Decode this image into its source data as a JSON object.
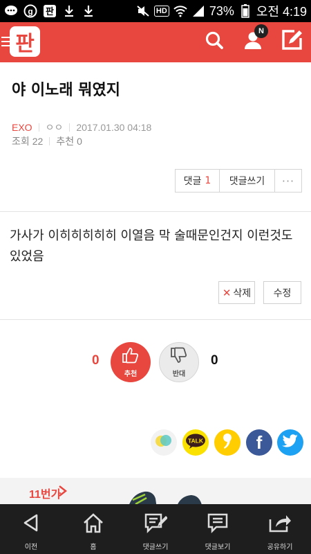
{
  "status_bar": {
    "battery": "73%",
    "time": "오전 4:19",
    "hd_label": "HD",
    "icons": [
      "chat-bubble-icon",
      "g-app-icon",
      "pan-app-icon",
      "download-icon",
      "download-icon",
      "mute-icon",
      "hd-icon",
      "wifi-icon",
      "signal-icon",
      "battery-icon"
    ]
  },
  "header": {
    "logo": "판",
    "notification_badge": "N",
    "icons": [
      "menu-icon",
      "search-icon",
      "user-icon",
      "write-icon"
    ],
    "color": "#e8473f"
  },
  "post": {
    "title": "야 이노래 뭐였지",
    "author": "EXO",
    "nickname": "ㅇㅇ",
    "date": "2017.01.30 04:18",
    "views_label": "조회",
    "views": "22",
    "recommend_label": "추천",
    "recommend": "0"
  },
  "actions": {
    "comment_label": "댓글",
    "comment_count": "1",
    "write_comment_label": "댓글쓰기",
    "more": "···"
  },
  "comment": {
    "text": "가사가 이히히히히히 이열음 막 술때문인건지 이런것도 있었음",
    "delete_label": "삭제",
    "edit_label": "수정"
  },
  "vote": {
    "up_count": "0",
    "up_label": "추천",
    "down_label": "반대",
    "down_count": "0"
  },
  "share": {
    "icons": [
      "share-multi-icon",
      "kakaotalk-icon",
      "kakaostory-icon",
      "facebook-icon",
      "twitter-icon"
    ],
    "talk_label": "TALK",
    "facebook_label": "f"
  },
  "ad": {
    "brand": "11번가"
  },
  "bottom_nav": {
    "items": [
      {
        "label": "이전",
        "icon": "back-icon"
      },
      {
        "label": "홈",
        "icon": "home-icon"
      },
      {
        "label": "댓글쓰기",
        "icon": "write-comment-icon"
      },
      {
        "label": "댓글보기",
        "icon": "view-comments-icon"
      },
      {
        "label": "공유하기",
        "icon": "share-icon"
      }
    ]
  }
}
